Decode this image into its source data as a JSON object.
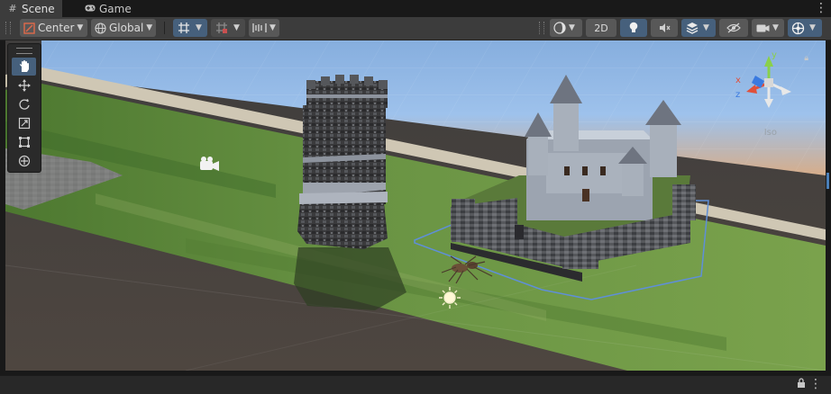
{
  "tabs": [
    {
      "label": "Scene",
      "icon": "hash-icon",
      "active": true
    },
    {
      "label": "Game",
      "icon": "gamepad-icon",
      "active": false
    }
  ],
  "toolbar": {
    "pivot_mode": "Center",
    "pivot_space": "Global",
    "mode_2d": "2D"
  },
  "tools": [
    "hand-tool",
    "move-tool",
    "rotate-tool",
    "scale-tool",
    "rect-tool",
    "transform-tool"
  ],
  "gizmo": {
    "x_label": "x",
    "y_label": "y",
    "z_label": "z",
    "projection": "Iso"
  },
  "colors": {
    "accent": "#46607c",
    "selection_outline": "#5f8fd8",
    "grass": "#5e8a3c",
    "ground": "#4d4842",
    "sky": "#8fb6e6"
  }
}
